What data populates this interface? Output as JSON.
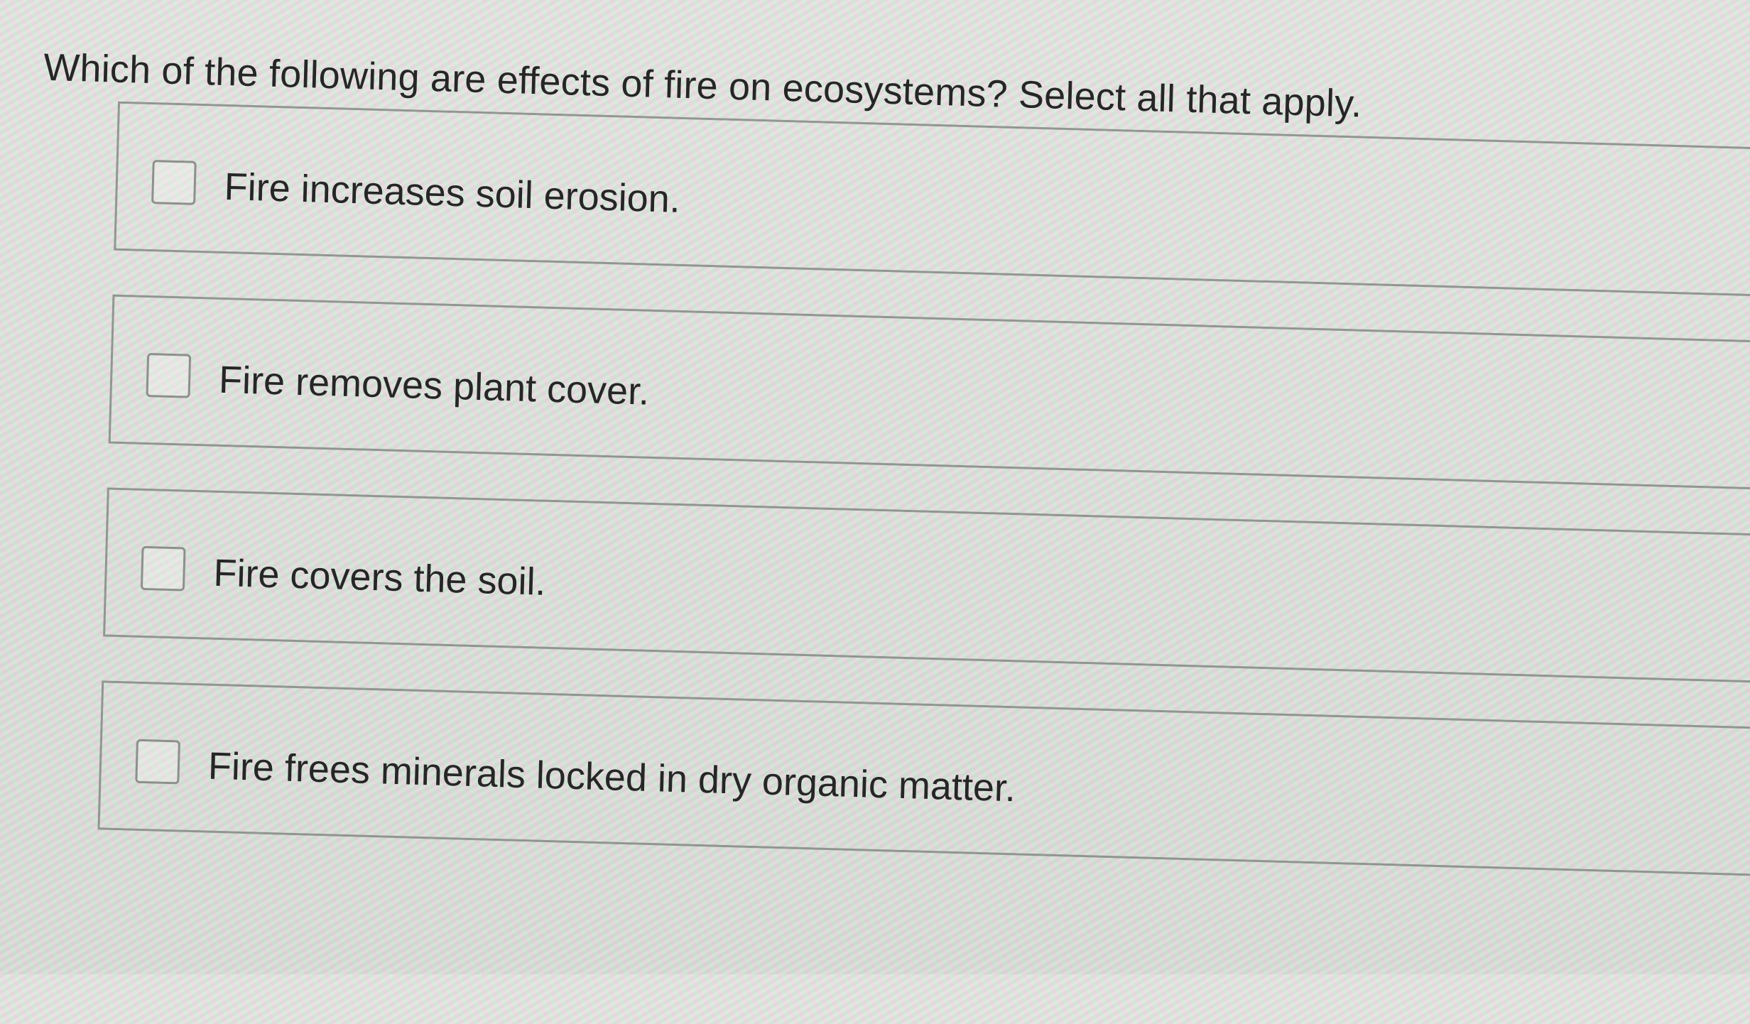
{
  "question": {
    "title": "Which of the following are effects of fire on ecosystems? Select all that apply."
  },
  "options": [
    {
      "label": "Fire increases soil erosion.",
      "checked": false
    },
    {
      "label": "Fire removes plant cover.",
      "checked": false
    },
    {
      "label": "Fire covers the soil.",
      "checked": false
    },
    {
      "label": "Fire frees minerals locked in dry organic matter.",
      "checked": false
    }
  ]
}
